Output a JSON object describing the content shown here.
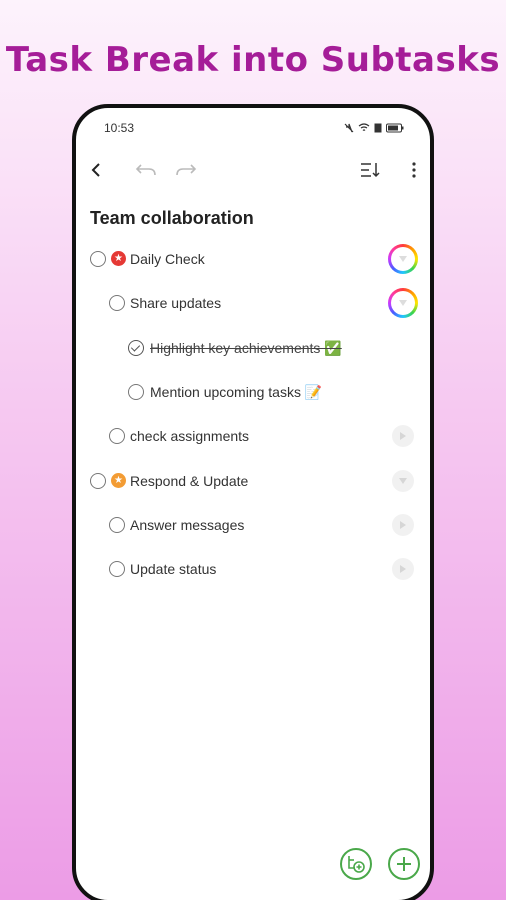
{
  "banner": {
    "title": "Task Break into Subtasks"
  },
  "status_bar": {
    "time": "10:53"
  },
  "toolbar": {
    "back_icon": "back-arrow-icon",
    "undo_icon": "undo-icon",
    "redo_icon": "redo-icon",
    "sort_icon": "sort-icon",
    "more_icon": "more-vert-icon"
  },
  "list": {
    "title": "Team collaboration",
    "items": [
      {
        "label": "Daily Check",
        "level": 0,
        "priority": "high",
        "checked": false,
        "action": "rainbow-ring"
      },
      {
        "label": "Share updates",
        "level": 1,
        "checked": false,
        "action": "rainbow-ring"
      },
      {
        "label": "Highlight key achievements ✅",
        "level": 2,
        "checked": true,
        "action": "none"
      },
      {
        "label": "Mention upcoming tasks 📝",
        "level": 2,
        "checked": false,
        "action": "none"
      },
      {
        "label": "check assignments",
        "level": 1,
        "checked": false,
        "action": "play"
      },
      {
        "label": "Respond & Update",
        "level": 0,
        "priority": "medium",
        "checked": false,
        "action": "play-down"
      },
      {
        "label": "Answer messages",
        "level": 1,
        "checked": false,
        "action": "play"
      },
      {
        "label": "Update status",
        "level": 1,
        "checked": false,
        "action": "play"
      }
    ]
  },
  "colors": {
    "banner_text": "#a51d98",
    "priority_high": "#e53935",
    "priority_medium": "#f39c34",
    "fab_green": "#4aa84a"
  }
}
